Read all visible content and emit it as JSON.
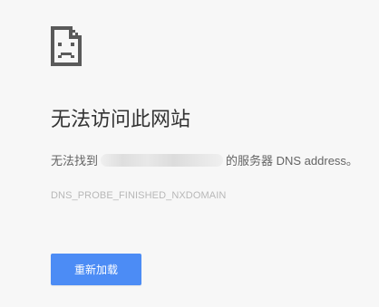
{
  "icon": "sad-page-icon",
  "title": "无法访问此网站",
  "message": {
    "prefix": "无法找到",
    "domain_redacted": "",
    "suffix": "的服务器 DNS address。"
  },
  "error_code": "DNS_PROBE_FINISHED_NXDOMAIN",
  "reload_label": "重新加载",
  "colors": {
    "background": "#f7f7f7",
    "button": "#4c8cf5",
    "title": "#333333",
    "error_code": "#b8b8b8"
  }
}
